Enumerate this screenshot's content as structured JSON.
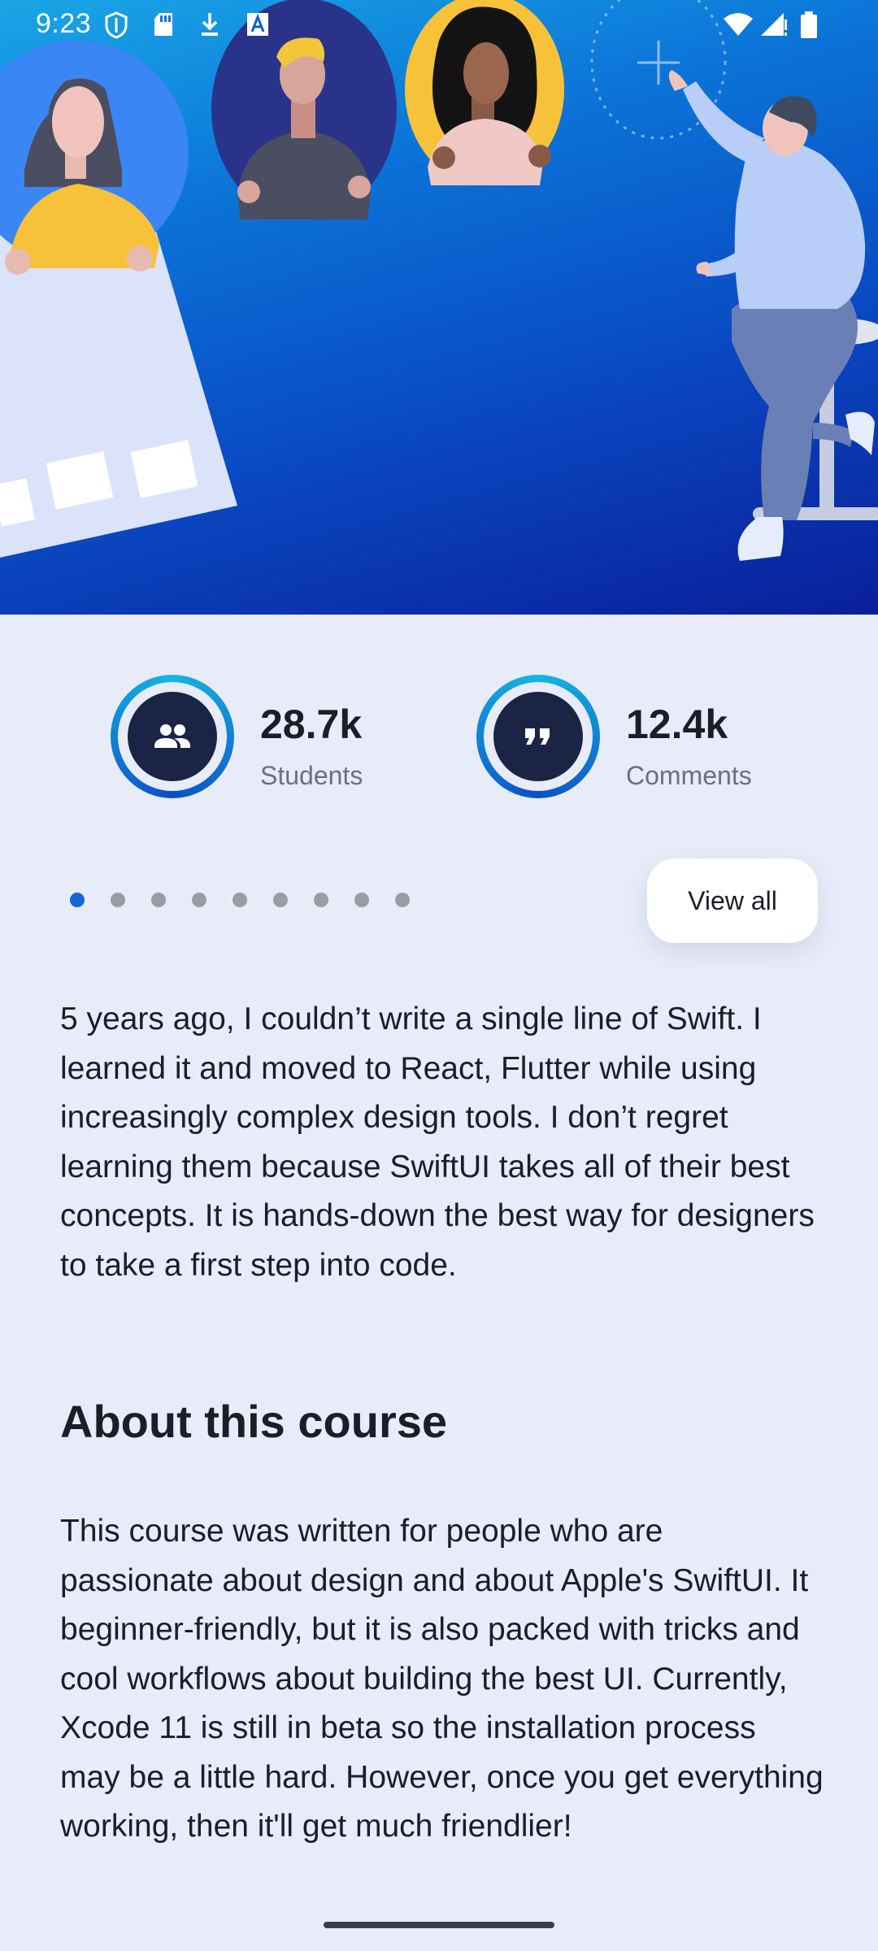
{
  "status_bar": {
    "time": "9:23",
    "icons": [
      "shield-icon",
      "sd-card-icon",
      "download-icon",
      "font-icon",
      "wifi-icon",
      "signal-icon",
      "battery-icon"
    ]
  },
  "hero": {
    "illustration": "people-avatars-illustration"
  },
  "stats": [
    {
      "value": "28.7k",
      "label": "Students",
      "icon": "people-icon"
    },
    {
      "value": "12.4k",
      "label": "Comments",
      "icon": "quote-icon"
    }
  ],
  "pager": {
    "count": 9,
    "active_index": 0
  },
  "view_all_label": "View all",
  "intro_text": "5 years ago, I couldn’t write a single line of Swift. I learned it and moved to React, Flutter while using increasingly complex design tools. I don’t regret learning them because SwiftUI takes all of their best concepts. It is hands-down the best way for designers to take a first step into code.",
  "about": {
    "title": "About this course",
    "text": "This course was written for people who are passionate about design and about Apple's SwiftUI. It beginner-friendly, but it is also packed with tricks and cool workflows about building the best UI. Currently, Xcode 11 is still in beta so the installation process may be a little hard. However, once you get everything working, then it'll get much friendlier!"
  },
  "colors": {
    "background": "#e8ecf8",
    "accent": "#1565d8",
    "icon_core": "#1b2444",
    "text_primary": "#1b1d29",
    "text_secondary": "#6b6f80"
  }
}
